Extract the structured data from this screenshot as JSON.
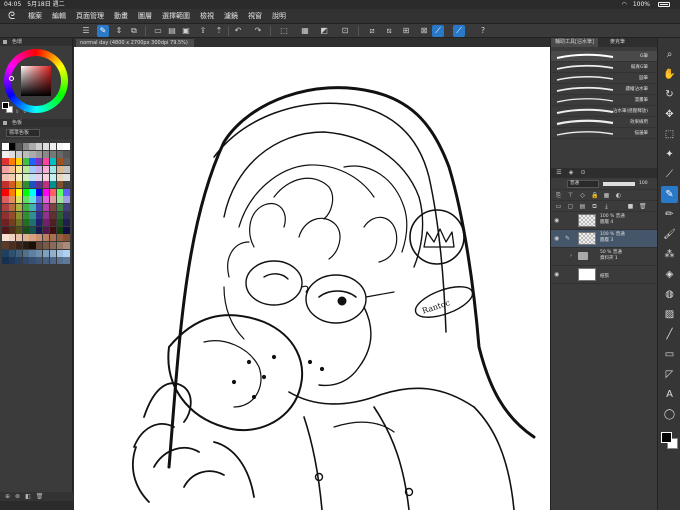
{
  "status": {
    "time": "04:05",
    "date": "5月18日 週二",
    "battery": "100%"
  },
  "menu": [
    "檔案",
    "編輯",
    "頁面管理",
    "動畫",
    "圖層",
    "選擇範圍",
    "檢視",
    "濾鏡",
    "視窗",
    "說明"
  ],
  "doc": {
    "tab_title": "normal day (4800 x 2700px 300dpi 79.5%)"
  },
  "color_panel": {
    "title": "色環",
    "values": [
      "0",
      "0",
      "0"
    ]
  },
  "color_set": {
    "title": "色板",
    "set_name": "標準色板"
  },
  "subtool": {
    "tabs": [
      "輔助工具[沾水筆]",
      "麥克筆"
    ],
    "brushes": [
      "G筆",
      "擬真G筆",
      "圓筆",
      "鏤繪沾水筆",
      "漫畫筆",
      "沾水筆(感壓釋放)",
      "效果線用",
      "描邊筆"
    ]
  },
  "layer": {
    "blend_mode": "普通",
    "opacity": "100",
    "layers": [
      {
        "line1": "100 %  普通",
        "line2": "圖層 4"
      },
      {
        "line1": "100 %  普通",
        "line2": "圖層 3"
      },
      {
        "line1": "50 %  普通",
        "line2": "資料夾 1"
      },
      {
        "line1": "",
        "line2": "紙張"
      }
    ]
  },
  "palette_colors": [
    [
      "#ffffff",
      "#000000",
      "#555555",
      "#888888",
      "#aaaaaa",
      "#cccccc",
      "#dddddd",
      "#eeeeee",
      "#f5f5f5",
      "#ffffff"
    ],
    [
      "#efefef",
      "#dedede",
      "#cdcdcd",
      "#bcbcbc",
      "#ababab",
      "#9a9a9a",
      "#898989",
      "#787878",
      "#676767",
      "#565656"
    ],
    [
      "#e03030",
      "#ff7f00",
      "#ffd400",
      "#40c040",
      "#2060ff",
      "#8030c0",
      "#ff40a0",
      "#00c0c0",
      "#a05020",
      "#606060"
    ],
    [
      "#f4a0a0",
      "#f8c090",
      "#f8e890",
      "#b8e8a0",
      "#a0c8f8",
      "#c8a8e8",
      "#f8b0d8",
      "#a0e8e8",
      "#d8b890",
      "#c0c0c0"
    ],
    [
      "#f0c0b0",
      "#f0d0b0",
      "#f8f0c0",
      "#d0f0c0",
      "#c0e0f8",
      "#e0d0f0",
      "#f8d0e0",
      "#c0f0f0",
      "#e8d8c0",
      "#e0e0e0"
    ],
    [
      "#c03030",
      "#d06020",
      "#d0b020",
      "#309030",
      "#2050c0",
      "#603090",
      "#c03080",
      "#009090",
      "#805030",
      "#404040"
    ],
    [
      "#ff0000",
      "#ff8000",
      "#ffff00",
      "#00ff00",
      "#00ffff",
      "#0000ff",
      "#ff00ff",
      "#ff6060",
      "#60ff60",
      "#6060ff"
    ],
    [
      "#e06060",
      "#e09060",
      "#e0e060",
      "#60e060",
      "#60e0e0",
      "#6060e0",
      "#e060e0",
      "#e0a0a0",
      "#a0e0a0",
      "#a0a0e0"
    ],
    [
      "#b04040",
      "#b07040",
      "#b0b040",
      "#40b040",
      "#40b0b0",
      "#4040b0",
      "#b040b0",
      "#804040",
      "#408040",
      "#404080"
    ],
    [
      "#903030",
      "#905030",
      "#909030",
      "#309030",
      "#309090",
      "#303090",
      "#903090",
      "#603030",
      "#306030",
      "#303060"
    ],
    [
      "#702020",
      "#704020",
      "#707020",
      "#207020",
      "#207070",
      "#202070",
      "#702070",
      "#502020",
      "#205020",
      "#202050"
    ],
    [
      "#501818",
      "#503018",
      "#505018",
      "#185018",
      "#185050",
      "#181850",
      "#501850",
      "#401010",
      "#104010",
      "#101040"
    ],
    [
      "#f8e0d0",
      "#f0d0c0",
      "#e8c0a8",
      "#e0b090",
      "#d8a080",
      "#c89070",
      "#b88060",
      "#a87050",
      "#986040",
      "#885030"
    ],
    [
      "#5a3a28",
      "#4a2e20",
      "#3a2418",
      "#2a1a10",
      "#1a1008",
      "#6a4a38",
      "#7a5a48",
      "#8a6a58",
      "#9a7a68",
      "#aa8a78"
    ],
    [
      "#204060",
      "#305070",
      "#406080",
      "#507090",
      "#6080a0",
      "#7090b0",
      "#80a0c0",
      "#90b0d0",
      "#a0c0e0",
      "#b0d0f0"
    ],
    [
      "#183050",
      "#203858",
      "#284060",
      "#304868",
      "#385070",
      "#405878",
      "#486080",
      "#506888",
      "#587090",
      "#607898"
    ]
  ]
}
